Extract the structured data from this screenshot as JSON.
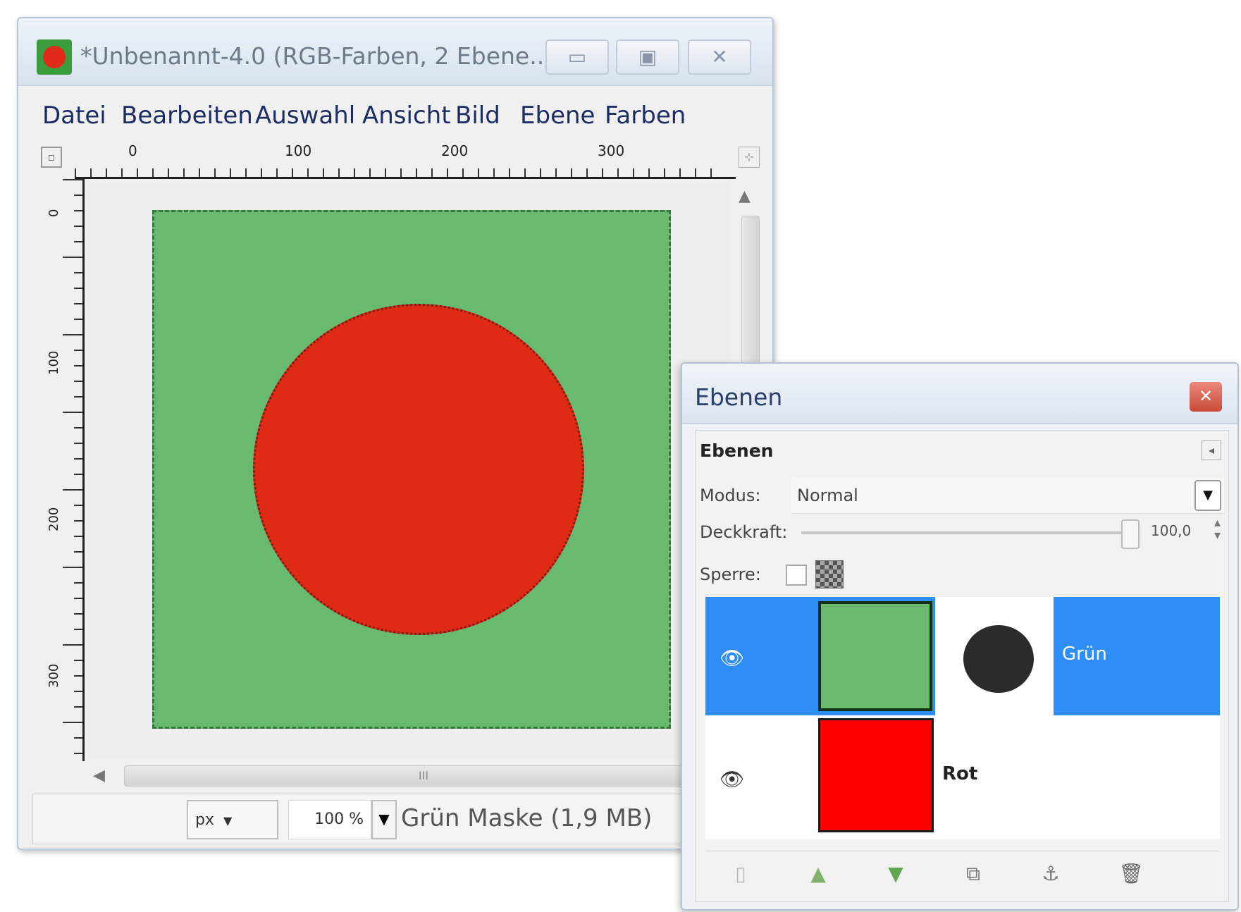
{
  "image_window": {
    "title": "*Unbenannt-4.0 (RGB-Farben, 2 Ebene...",
    "menu": [
      "Datei",
      "Bearbeiten",
      "Auswahl",
      "Ansicht",
      "Bild",
      "Ebene",
      "Farben"
    ],
    "ruler_h_labels": [
      "0",
      "100",
      "200",
      "300"
    ],
    "ruler_v_labels": [
      "0",
      "100",
      "200",
      "300"
    ],
    "scroll_grip": "III",
    "statusbar": {
      "unit": "px",
      "zoom": "100 %",
      "status_text": "Grün Maske (1,9 MB)"
    },
    "colors": {
      "green_layer": "#68ba6f",
      "red_circle": "#df2a16"
    }
  },
  "layers_dock": {
    "title": "Ebenen",
    "tab_label": "Ebenen",
    "mode_label": "Modus:",
    "mode_value": "Normal",
    "opacity_label": "Deckkraft:",
    "opacity_value": "100,0",
    "lock_label": "Sperre:",
    "layers": [
      {
        "name": "Grün",
        "visible": true,
        "selected": true,
        "has_mask": true
      },
      {
        "name": "Rot",
        "visible": true,
        "selected": false,
        "has_mask": false
      }
    ],
    "toolbar_icons": [
      "new-layer-icon",
      "raise-layer-icon",
      "lower-layer-icon",
      "duplicate-layer-icon",
      "anchor-icon",
      "delete-icon"
    ]
  },
  "icons": {
    "eye": "👁",
    "dropdown": "▼",
    "close": "✕",
    "scroll_up": "▲",
    "scroll_left": "◀"
  }
}
